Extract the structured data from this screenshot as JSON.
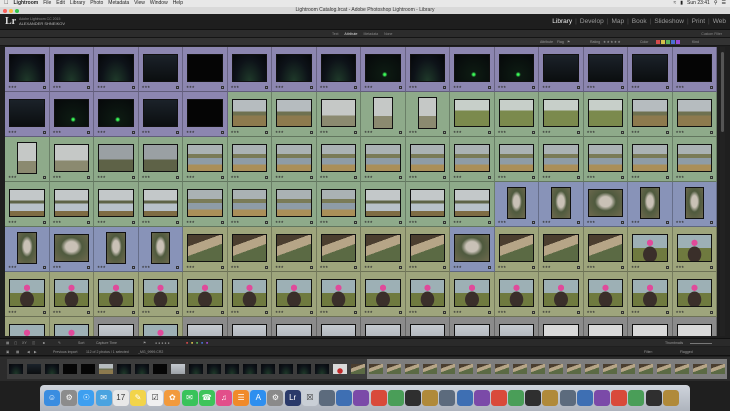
{
  "menubar": {
    "app": "Lightroom",
    "items": [
      "File",
      "Edit",
      "Library",
      "Photo",
      "Metadata",
      "View",
      "Window",
      "Help"
    ],
    "clock": "Sun 23:41"
  },
  "window": {
    "title": "Lightroom Catalog.lrcat - Adobe Photoshop Lightroom - Library"
  },
  "identity": {
    "logo": "Lr",
    "line1": "Adobe Lightroom CC 2015",
    "user": "ALEXANDER SHNEIKOV"
  },
  "modules": [
    "Library",
    "Develop",
    "Map",
    "Book",
    "Slideshow",
    "Print",
    "Web"
  ],
  "active_module": "Library",
  "filter_tabs": [
    "Text",
    "Attribute",
    "Metadata",
    "None"
  ],
  "active_filter_tab": "Attribute",
  "filter_row": {
    "attribute_label": "Attribute",
    "flag_label": "Flag",
    "rating_label": "Rating",
    "color_label": "Color",
    "kind_label": "Kind",
    "preset": "Custom Filter"
  },
  "grid": {
    "rows": [
      {
        "tint": "purple",
        "cells": [
          "night",
          "night",
          "night",
          "dark",
          "black",
          "night",
          "night",
          "night",
          "night-green",
          "night",
          "night-green",
          "night-green",
          "dark",
          "dark",
          "dark",
          "black"
        ]
      },
      {
        "tint": "purple-green",
        "cells": [
          "dark",
          "night-green",
          "night-green",
          "dark",
          "black",
          "marsh",
          "marsh",
          "tree",
          "tree",
          "tree",
          "flower",
          "flower",
          "flower",
          "flower",
          "marsh",
          "marsh"
        ]
      },
      {
        "tint": "green",
        "cells": [
          "tree",
          "tree",
          "foggy",
          "foggy",
          "lake",
          "lake",
          "lake",
          "lake",
          "lake",
          "lake",
          "lake",
          "lake",
          "lake",
          "lake",
          "lake",
          "lake"
        ]
      },
      {
        "tint": "green-blue",
        "cells": [
          "lake2",
          "lake2",
          "lake2",
          "lake2",
          "lake",
          "lake",
          "lake",
          "lake",
          "lake2",
          "lake2",
          "lake2",
          "hand",
          "hand",
          "hand",
          "hand",
          "hand"
        ]
      },
      {
        "tint": "blue-olive",
        "cells": [
          "hand",
          "hand",
          "hand",
          "hand",
          "wood",
          "wood",
          "wood",
          "wood",
          "wood",
          "wood",
          "hand",
          "wood",
          "wood",
          "wood",
          "person",
          "person"
        ]
      },
      {
        "tint": "olive",
        "cells": [
          "person",
          "person",
          "person",
          "person",
          "person",
          "person",
          "person",
          "person",
          "person",
          "person",
          "person",
          "person",
          "person",
          "person",
          "person",
          "person"
        ]
      },
      {
        "tint": "olive-gray",
        "cells": [
          "person",
          "person",
          "sky",
          "person",
          "sky",
          "sky",
          "sky",
          "sky",
          "sky",
          "sky",
          "sky",
          "sky",
          "redbox",
          "redbox",
          "redbox",
          "redbox"
        ]
      }
    ]
  },
  "toolbar": {
    "sort_label": "Sort",
    "sort_value": "Capture Time",
    "thumbnails_label": "Thumbnails"
  },
  "filmstrip_header": {
    "source": "Previous Import",
    "count_text": "112 of 2 photos / 1 selected",
    "file_name": "_MG_9999.CR2",
    "filter_label": "Filter:",
    "filter_value": "Flagged"
  },
  "dock_icons": [
    "finder-icon",
    "launchpad-icon",
    "safari-icon",
    "mail-icon",
    "calendar-icon",
    "notes-icon",
    "reminders-icon",
    "photos-icon",
    "messages-icon",
    "facetime-icon",
    "itunes-icon",
    "ibooks-icon",
    "appstore-icon",
    "preferences-icon",
    "lightroom-icon",
    "trash-icon"
  ]
}
